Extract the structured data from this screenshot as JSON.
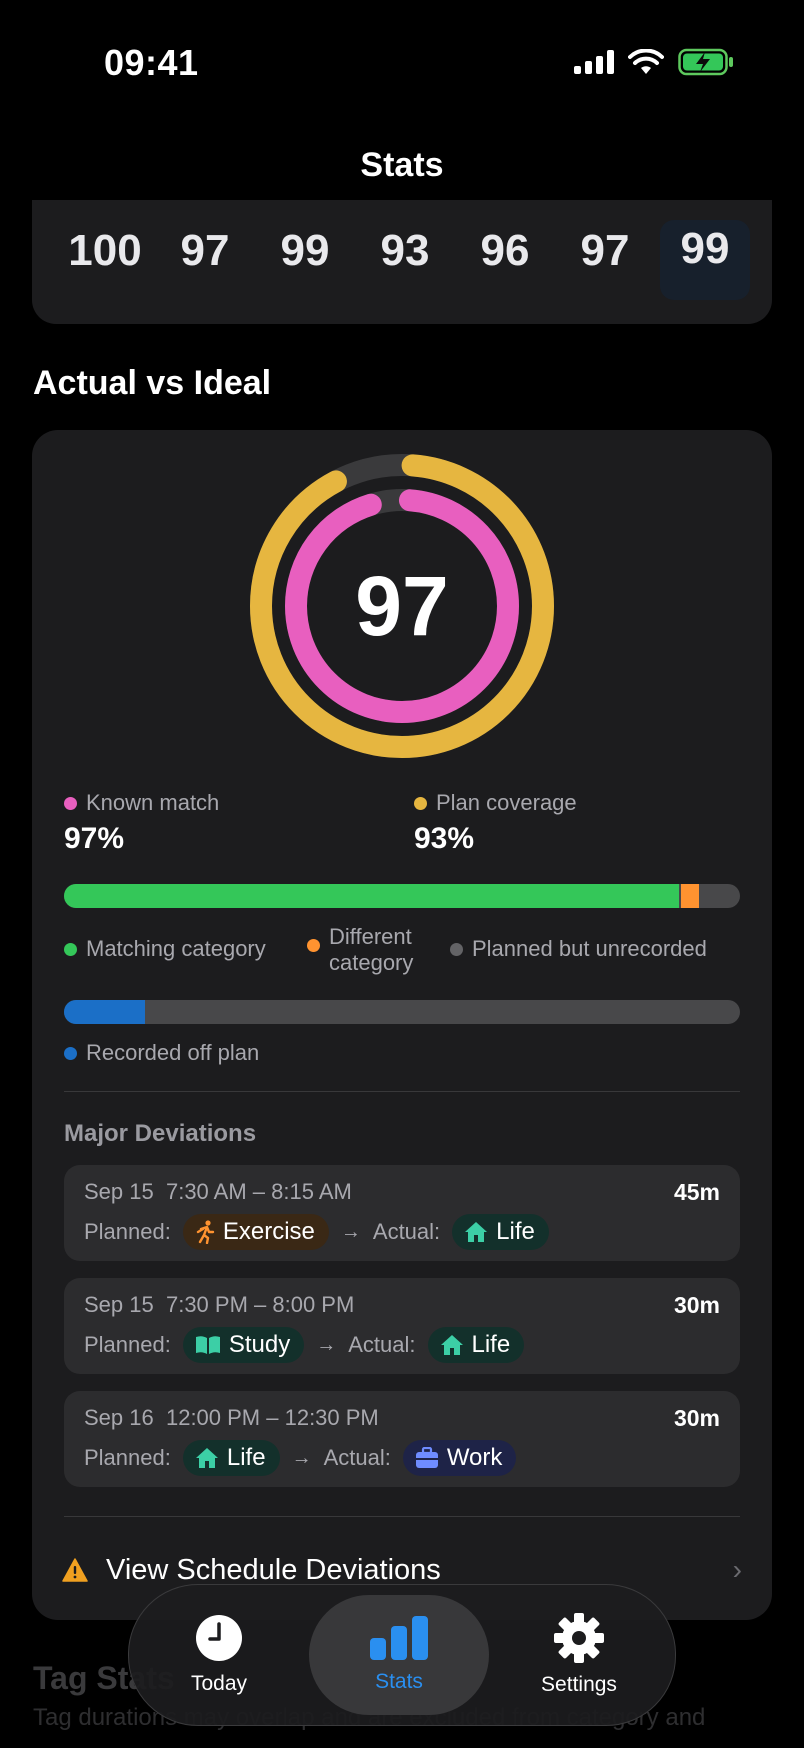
{
  "status_bar": {
    "time": "09:41"
  },
  "header": {
    "title": "Stats"
  },
  "scores": {
    "values": [
      "100",
      "97",
      "99",
      "93",
      "96",
      "97",
      "99"
    ],
    "today_index": 6
  },
  "actual_vs_ideal": {
    "title": "Actual vs Ideal",
    "score": "97",
    "known_match": {
      "label": "Known match",
      "value": "97%",
      "fraction": 0.97,
      "color": "#e85fbf"
    },
    "plan_coverage": {
      "label": "Plan coverage",
      "value": "93%",
      "fraction": 0.93,
      "color": "#e6b640"
    },
    "planned_bar": {
      "matching_fraction": 0.91,
      "different_fraction": 0.027,
      "unrecorded_fraction": 0.063
    },
    "legend": {
      "matching": "Matching category",
      "different": "Different category",
      "unrecorded": "Planned but unrecorded"
    },
    "offplan_bar": {
      "fraction": 0.12,
      "label": "Recorded off plan"
    },
    "colors": {
      "green": "#34c759",
      "orange": "#ff9330",
      "gray": "#636366",
      "blue": "#1b6fc7"
    }
  },
  "major_deviations": {
    "title": "Major Deviations",
    "planned_label": "Planned:",
    "actual_label": "Actual:",
    "items": [
      {
        "date": "Sep 15",
        "time": "7:30 AM – 8:15 AM",
        "duration": "45m",
        "planned": "Exercise",
        "planned_icon": "running-icon",
        "actual": "Life",
        "actual_icon": "house-icon"
      },
      {
        "date": "Sep 15",
        "time": "7:30 PM – 8:00 PM",
        "duration": "30m",
        "planned": "Study",
        "planned_icon": "book-icon",
        "actual": "Life",
        "actual_icon": "house-icon"
      },
      {
        "date": "Sep 16",
        "time": "12:00 PM – 12:30 PM",
        "duration": "30m",
        "planned": "Life",
        "planned_icon": "house-icon",
        "actual": "Work",
        "actual_icon": "briefcase-icon"
      }
    ],
    "view_all": "View Schedule Deviations"
  },
  "tag_stats": {
    "title": "Tag Stats",
    "description": "Tag durations may overlap and are excluded from category and"
  },
  "tabbar": {
    "tabs": [
      {
        "label": "Today",
        "icon": "clock-icon"
      },
      {
        "label": "Stats",
        "icon": "bar-chart-icon",
        "active": true
      },
      {
        "label": "Settings",
        "icon": "gear-icon"
      }
    ]
  }
}
